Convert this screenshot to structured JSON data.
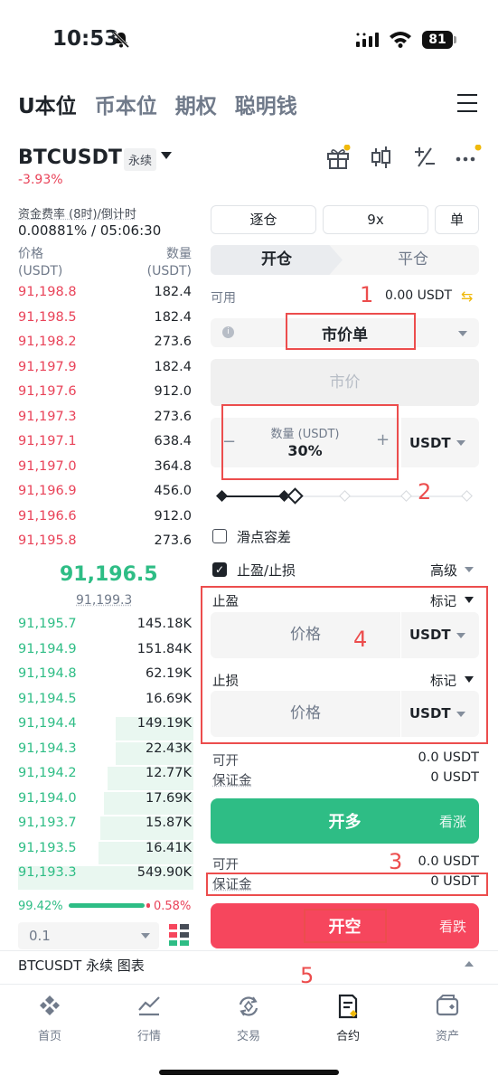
{
  "status_bar": {
    "time": "10:53",
    "battery": "81"
  },
  "top_tabs": [
    "U本位",
    "币本位",
    "期权",
    "聪明钱"
  ],
  "symbol": {
    "name": "BTCUSDT",
    "type": "永续",
    "change": "-3.93%"
  },
  "funding": {
    "label": "资金费率 (8时)/倒计时",
    "value": "0.00881% / 05:06:30"
  },
  "orderbook": {
    "price_header": "价格",
    "price_unit": "(USDT)",
    "qty_header": "数量",
    "qty_unit": "(USDT)",
    "asks": [
      {
        "price": "91,198.8",
        "qty": "182.4"
      },
      {
        "price": "91,198.5",
        "qty": "182.4"
      },
      {
        "price": "91,198.2",
        "qty": "273.6"
      },
      {
        "price": "91,197.9",
        "qty": "182.4"
      },
      {
        "price": "91,197.6",
        "qty": "912.0"
      },
      {
        "price": "91,197.3",
        "qty": "273.6"
      },
      {
        "price": "91,197.1",
        "qty": "638.4"
      },
      {
        "price": "91,197.0",
        "qty": "364.8"
      },
      {
        "price": "91,196.9",
        "qty": "456.0"
      },
      {
        "price": "91,196.6",
        "qty": "912.0"
      },
      {
        "price": "91,195.8",
        "qty": "273.6"
      }
    ],
    "last_price": "91,196.5",
    "mark_price": "91,199.3",
    "bids": [
      {
        "price": "91,195.7",
        "qty": "145.18K",
        "depth": 0.0
      },
      {
        "price": "91,194.9",
        "qty": "151.84K",
        "depth": 0.0
      },
      {
        "price": "91,194.8",
        "qty": "62.19K",
        "depth": 0.0
      },
      {
        "price": "91,194.5",
        "qty": "16.69K",
        "depth": 0.0
      },
      {
        "price": "91,194.4",
        "qty": "149.19K",
        "depth": 0.41
      },
      {
        "price": "91,194.3",
        "qty": "22.43K",
        "depth": 0.41
      },
      {
        "price": "91,194.2",
        "qty": "12.77K",
        "depth": 0.45
      },
      {
        "price": "91,194.0",
        "qty": "17.69K",
        "depth": 0.47
      },
      {
        "price": "91,193.7",
        "qty": "15.87K",
        "depth": 0.49
      },
      {
        "price": "91,193.5",
        "qty": "16.41K",
        "depth": 0.5
      },
      {
        "price": "91,193.3",
        "qty": "549.90K",
        "depth": 1.0
      }
    ],
    "buy_ratio": "99.42%",
    "sell_ratio": "0.58%",
    "depth_precision": "0.1"
  },
  "order_panel": {
    "margin_mode": "逐仓",
    "leverage": "9x",
    "position_mode": "单",
    "open_tab": "开仓",
    "close_tab": "平仓",
    "available_label": "可用",
    "available_value": "0.00 USDT",
    "order_type": "市价单",
    "market_price_placeholder": "市价",
    "qty_label": "数量 (USDT)",
    "qty_value": "30%",
    "qty_unit": "USDT",
    "slippage_label": "滑点容差",
    "tpsl_label": "止盈/止损",
    "advanced_label": "高级",
    "take_profit_label": "止盈",
    "stop_loss_label": "止损",
    "mark_label": "标记",
    "price_placeholder": "价格",
    "unit_usdt": "USDT",
    "long_openable_label": "可开",
    "long_openable_value": "0.0 USDT",
    "long_margin_label": "保证金",
    "long_margin_value": "0 USDT",
    "long_button": "开多",
    "long_side": "看涨",
    "short_openable_label": "可开",
    "short_openable_value": "0.0 USDT",
    "short_margin_label": "保证金",
    "short_margin_value": "0 USDT",
    "short_button": "开空",
    "short_side": "看跌"
  },
  "annotations": [
    "1",
    "2",
    "3",
    "4",
    "5"
  ],
  "chart_bar": {
    "label": "BTCUSDT 永续  图表"
  },
  "bottom_nav": [
    "首页",
    "行情",
    "交易",
    "合约",
    "资产"
  ],
  "colors": {
    "buy": "#2ebd85",
    "sell": "#f6465d",
    "accent": "#f0b90b",
    "annotation": "#ec4d4d"
  }
}
